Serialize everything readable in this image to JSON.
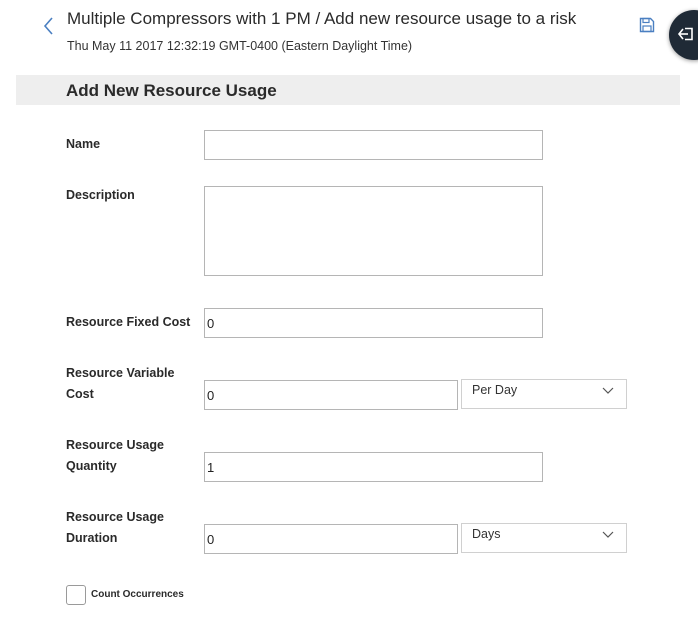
{
  "header": {
    "title": "Multiple Compressors with 1 PM / Add new resource usage to a risk",
    "subtitle": "Thu May 11 2017 12:32:19 GMT-0400 (Eastern Daylight Time)",
    "back_icon": "chevron-left-icon",
    "save_icon": "save-icon",
    "exit_icon": "exit-icon"
  },
  "section": {
    "title": "Add New Resource Usage"
  },
  "form": {
    "name": {
      "label": "Name",
      "value": ""
    },
    "description": {
      "label": "Description",
      "value": ""
    },
    "fixed_cost": {
      "label": "Resource Fixed Cost",
      "value": "0"
    },
    "variable_cost": {
      "label_line1": "Resource Variable",
      "label_line2": "Cost",
      "value": "0",
      "unit": "Per Day"
    },
    "quantity": {
      "label_line1": "Resource Usage",
      "label_line2": "Quantity",
      "value": "1"
    },
    "duration": {
      "label_line1": "Resource Usage",
      "label_line2": "Duration",
      "value": "0",
      "unit": "Days"
    },
    "count_occurrences": {
      "label": "Count Occurrences",
      "checked": false
    }
  },
  "colors": {
    "accent": "#4a7fc1",
    "header_bg": "#eeeeee",
    "exit_bg": "#1f2a36"
  }
}
